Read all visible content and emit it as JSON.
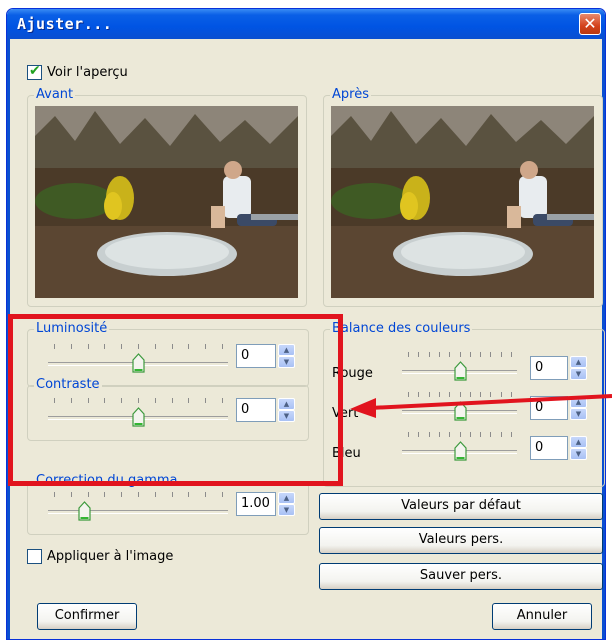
{
  "window": {
    "title": "Ajuster...",
    "close_symbol": "✕"
  },
  "preview": {
    "checkbox_label": "Voir l'aperçu",
    "checked": true,
    "before_label": "Avant",
    "after_label": "Après"
  },
  "left": {
    "luminosite": {
      "label": "Luminosité",
      "value": "0",
      "level": 0.5
    },
    "contraste": {
      "label": "Contraste",
      "value": "0",
      "level": 0.5
    },
    "gamma": {
      "label": "Correction du gamma",
      "value": "1.00",
      "level": 0.18
    }
  },
  "balance": {
    "title": "Balance des couleurs",
    "rouge": {
      "label": "Rouge",
      "value": "0",
      "level": 0.5
    },
    "vert": {
      "label": "Vert",
      "value": "0",
      "level": 0.5
    },
    "bleu": {
      "label": "Bleu",
      "value": "0",
      "level": 0.5
    }
  },
  "buttons": {
    "defaults": "Valeurs par défaut",
    "custom": "Valeurs pers.",
    "save_custom": "Sauver pers.",
    "confirm": "Confirmer",
    "cancel": "Annuler"
  },
  "apply": {
    "label": "Appliquer à l'image",
    "checked": false
  },
  "colors": {
    "title_bar": "#0054e3",
    "group_title": "#0046d5",
    "highlight": "#e1141e",
    "dialog_bg": "#ece9d8"
  }
}
